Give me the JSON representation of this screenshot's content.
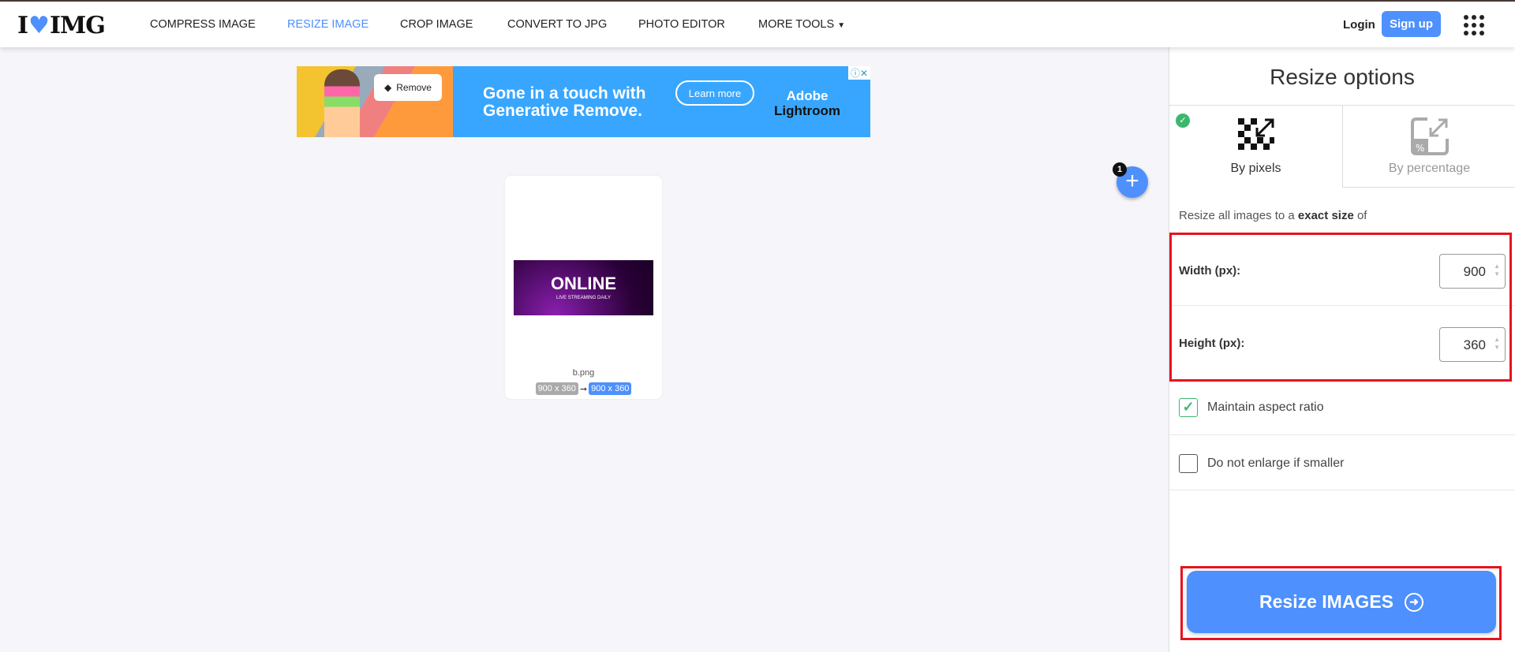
{
  "header": {
    "logo": "I❤IMG",
    "nav": [
      "COMPRESS IMAGE",
      "RESIZE IMAGE",
      "CROP IMAGE",
      "CONVERT TO JPG",
      "PHOTO EDITOR",
      "MORE TOOLS"
    ],
    "active_nav": "RESIZE IMAGE",
    "login": "Login",
    "signup": "Sign up"
  },
  "ad": {
    "remove": "Remove",
    "headline_1": "Gone in a touch with",
    "headline_2": "Generative Remove.",
    "cta": "Learn more",
    "brand_1": "Adobe",
    "brand_2": "Lightroom"
  },
  "file": {
    "thumb_title": "ONLINE",
    "thumb_sub": "LIVE STREAMING DAILY",
    "name": "b.png",
    "original_size": "900 x 360",
    "new_size": "900 x 360",
    "count": "1"
  },
  "sidebar": {
    "title": "Resize options",
    "tabs": [
      {
        "label": "By pixels",
        "selected": true
      },
      {
        "label": "By percentage",
        "selected": false
      }
    ],
    "intro_1": "Resize all images to a ",
    "intro_bold": "exact size",
    "intro_2": " of",
    "width_label": "Width (px):",
    "width_value": "900",
    "height_label": "Height (px):",
    "height_value": "360",
    "maintain_label": "Maintain aspect ratio",
    "maintain_checked": true,
    "enlarge_label": "Do not enlarge if smaller",
    "enlarge_checked": false,
    "submit": "Resize IMAGES"
  },
  "colors": {
    "accent": "#4d90fe",
    "check": "#3cb86e",
    "highlight": "#e8121f"
  }
}
